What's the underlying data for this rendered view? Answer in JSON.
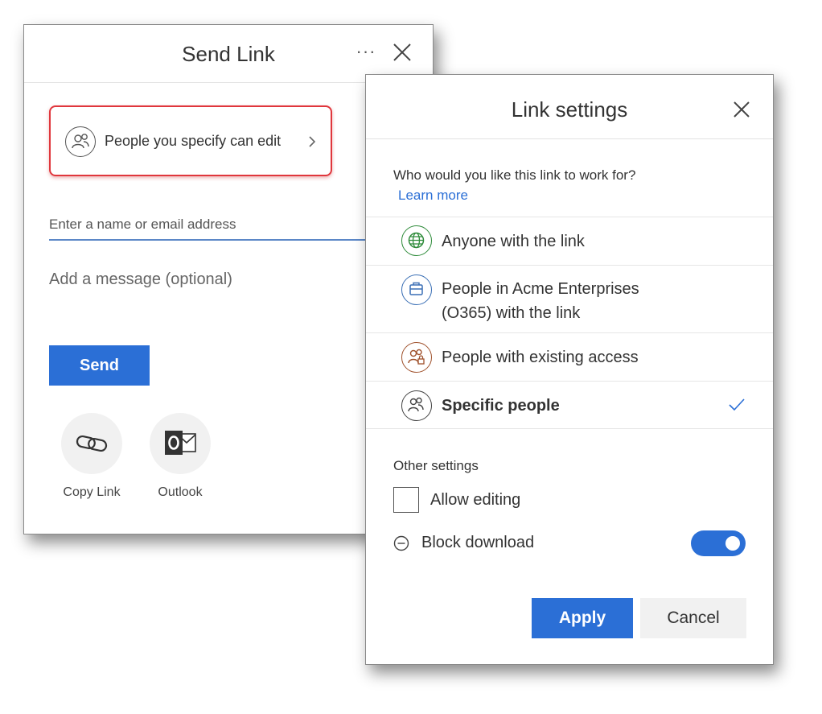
{
  "send_link": {
    "title": "Send Link",
    "more_label": "···",
    "permission_label": "People you specify can edit",
    "recipient_placeholder": "Enter a name or email address",
    "message_placeholder": "Add a message (optional)",
    "send_label": "Send",
    "share_options": [
      {
        "label": "Copy Link",
        "icon": "link-icon"
      },
      {
        "label": "Outlook",
        "icon": "outlook-icon"
      }
    ]
  },
  "link_settings": {
    "title": "Link settings",
    "question": "Who would you like this link to work for?",
    "learn_more": "Learn more",
    "options": [
      {
        "line1": "Anyone with the link",
        "line2": "",
        "icon": "globe-icon",
        "color": "#2e8b3a",
        "selected": false
      },
      {
        "line1": "People in Acme Enterprises",
        "line2": "(O365) with the link",
        "icon": "building-icon",
        "color": "#3a6fb5",
        "selected": false
      },
      {
        "line1": "People with existing access",
        "line2": "",
        "icon": "people-lock-icon",
        "color": "#a0522d",
        "selected": false
      },
      {
        "line1": "Specific people",
        "line2": "",
        "icon": "people-icon",
        "color": "#444444",
        "selected": true
      }
    ],
    "other_settings_label": "Other settings",
    "allow_editing_label": "Allow editing",
    "allow_editing_checked": false,
    "block_download_label": "Block download",
    "block_download_on": true,
    "apply_label": "Apply",
    "cancel_label": "Cancel"
  },
  "colors": {
    "accent": "#2b6fd6",
    "highlight": "#e0363c"
  }
}
